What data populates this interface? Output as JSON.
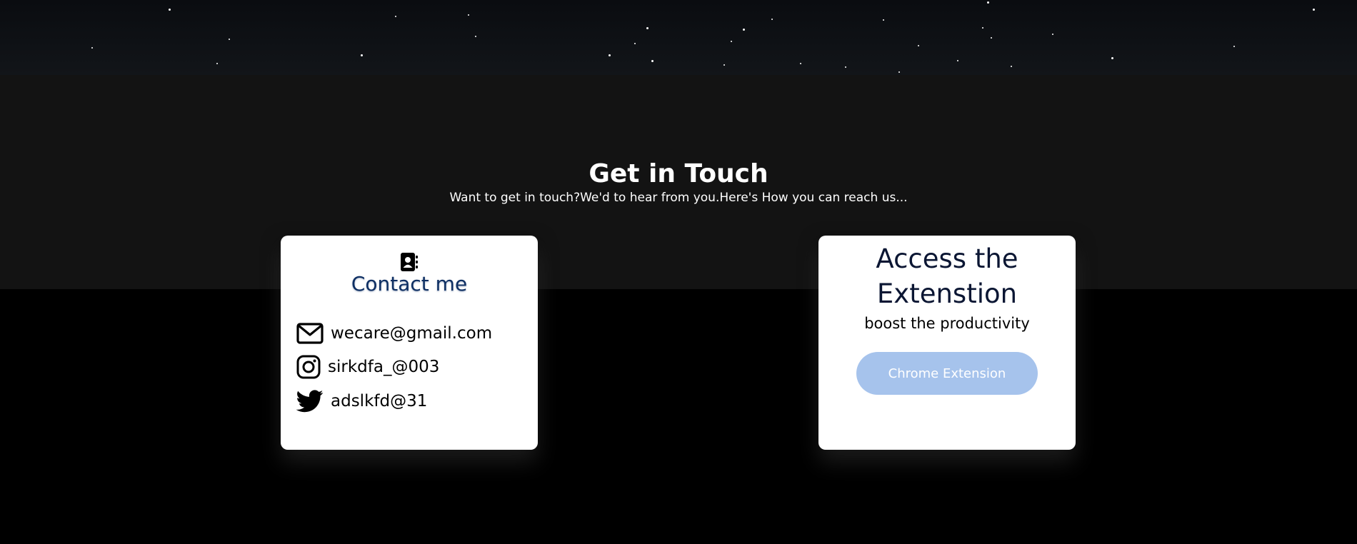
{
  "header": {
    "title": "Get in Touch",
    "subtitle": "Want to get in touch?We'd to hear from you.Here's How you can reach us..."
  },
  "contact_card": {
    "icon": "contact-book-icon",
    "title": "Contact me",
    "items": [
      {
        "icon": "mail-icon",
        "text": "wecare@gmail.com"
      },
      {
        "icon": "instagram-icon",
        "text": "sirkdfa_@003"
      },
      {
        "icon": "twitter-icon",
        "text": "adslkfd@31"
      }
    ]
  },
  "extension_card": {
    "title": "Access the Extenstion",
    "subtitle": "boost the productivity",
    "button_label": "Chrome Extension"
  },
  "colors": {
    "band": "#131313",
    "background": "#000000",
    "card": "#ffffff",
    "contact_title": "#0e2f63",
    "button": "#a6c3ec"
  }
}
